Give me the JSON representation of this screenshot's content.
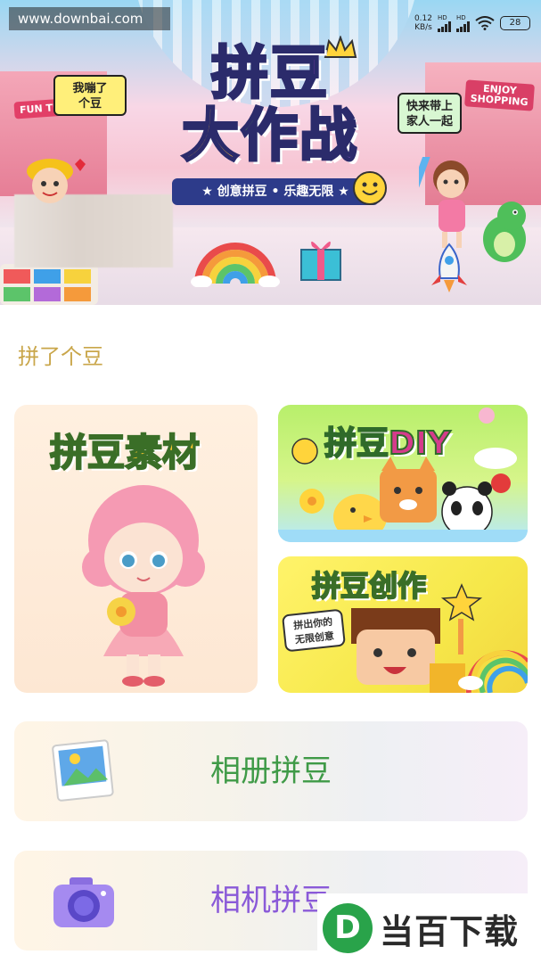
{
  "watermark_top": "www.downbai.com",
  "status": {
    "speed": "0.12",
    "speed_unit": "KB/s",
    "net1": "HD",
    "net2": "HD",
    "battery": "28"
  },
  "hero": {
    "title_line1": "拼豆",
    "title_line2_a": "大",
    "title_line2_b": "作",
    "title_line2_c": "战",
    "ribbon": "★ 创意拼豆 • 乐趣无限 ★",
    "bubble_left": "我嘣了\n个豆",
    "bubble_right": "快来带上\n家人一起",
    "sign_left": "FUN TIME",
    "sign_right": "ENJOY\nSHOPPING"
  },
  "section": {
    "title": "拼了个豆"
  },
  "cards": {
    "material": {
      "title": "拼豆素材"
    },
    "diy": {
      "title_a": "拼豆",
      "title_b": "DIY"
    },
    "create": {
      "title": "拼豆创作",
      "tag": "拼出你的\n无限创意"
    }
  },
  "actions": {
    "album": {
      "label": "相册拼豆",
      "icon": "photo-album-icon"
    },
    "camera": {
      "label": "相机拼豆",
      "icon": "camera-icon"
    }
  },
  "watermark_bottom": {
    "logo": "D",
    "text": "当百下载"
  },
  "colors": {
    "section_title": "#c9a64a",
    "album_label": "#3f9a47",
    "camera_label": "#8a5ad8"
  }
}
